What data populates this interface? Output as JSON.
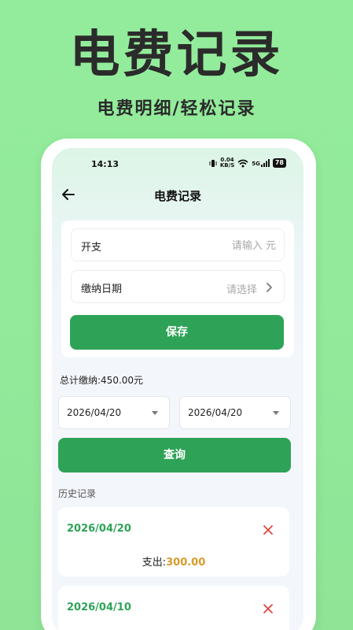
{
  "promo": {
    "title": "电费记录",
    "subtitle": "电费明细/轻松记录"
  },
  "status_bar": {
    "time": "14:13",
    "net_speed": "0.04",
    "net_unit": "KB/S",
    "network": "5G",
    "battery": "78"
  },
  "header": {
    "title": "电费记录"
  },
  "form": {
    "expense_label": "开支",
    "expense_placeholder": "请输入 元",
    "date_label": "缴纳日期",
    "date_placeholder": "请选择",
    "save_label": "保存"
  },
  "summary": {
    "total_text": "总计缴纳:450.00元"
  },
  "filter": {
    "start_date": "2026/04/20",
    "end_date": "2026/04/20",
    "query_label": "查询"
  },
  "history": {
    "label": "历史记录",
    "records": [
      {
        "date": "2026/04/20",
        "amount_label": "支出:",
        "amount": "300.00"
      },
      {
        "date": "2026/04/10"
      }
    ]
  },
  "colors": {
    "accent": "#2ea357",
    "amount": "#d89a2a",
    "delete": "#e0453d",
    "background": "#93ec9b"
  }
}
